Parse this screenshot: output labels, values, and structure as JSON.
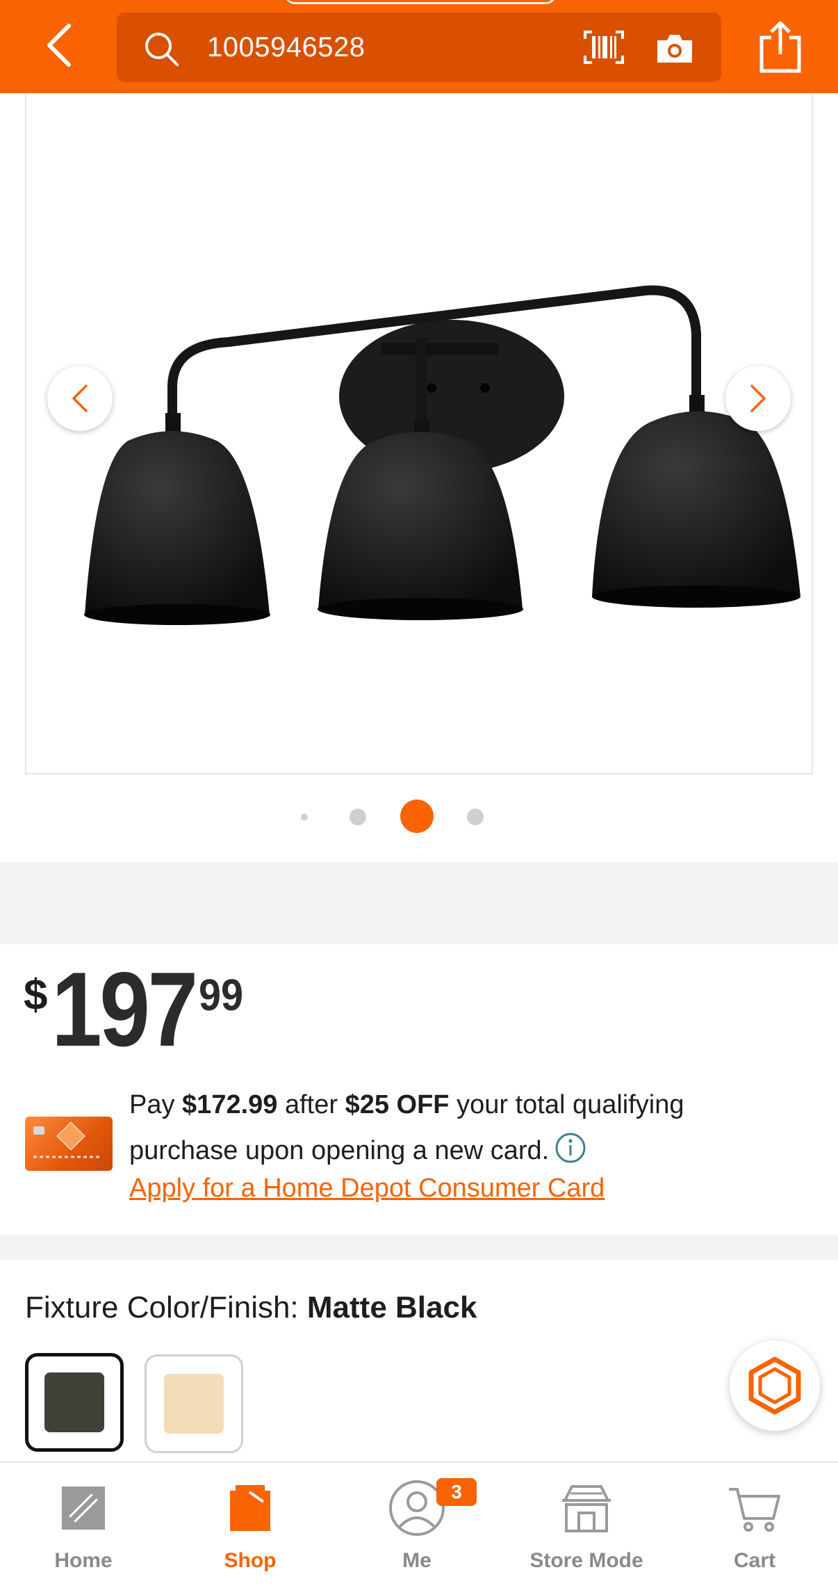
{
  "colors": {
    "brand": "#f96302",
    "search_bg": "#d95100",
    "text": "#1e1e1e",
    "muted": "#8a8a8a"
  },
  "header": {
    "back_icon": "chevron-left-icon",
    "search_value": "1005946528",
    "search_icon": "search-icon",
    "barcode_icon": "barcode-icon",
    "camera_icon": "camera-icon",
    "share_icon": "share-icon"
  },
  "gallery": {
    "slide_count": 4,
    "active_slide": 3,
    "prev_icon": "chevron-left-icon",
    "next_icon": "chevron-right-icon"
  },
  "price": {
    "currency": "$",
    "dollars": "197",
    "cents": "99"
  },
  "promo": {
    "pay_prefix": "Pay ",
    "pay_amount": "$172.99",
    "mid_text": " after ",
    "discount": "$25 OFF",
    "suffix": " your total qualifying purchase upon opening a new card.",
    "link": "Apply for a Home Depot Consumer Card"
  },
  "options": {
    "label": "Fixture Color/Finish: ",
    "selected": "Matte Black",
    "swatches": [
      {
        "color": "#3f4238",
        "selected": true
      },
      {
        "color": "#f3dcb8",
        "selected": false
      }
    ]
  },
  "nav": {
    "items": [
      {
        "label": "Home",
        "icon": "home-depot-logo-icon"
      },
      {
        "label": "Shop",
        "icon": "shop-icon"
      },
      {
        "label": "Me",
        "icon": "profile-icon",
        "badge": "3"
      },
      {
        "label": "Store Mode",
        "icon": "store-icon"
      },
      {
        "label": "Cart",
        "icon": "cart-icon"
      }
    ],
    "active": "Shop"
  }
}
